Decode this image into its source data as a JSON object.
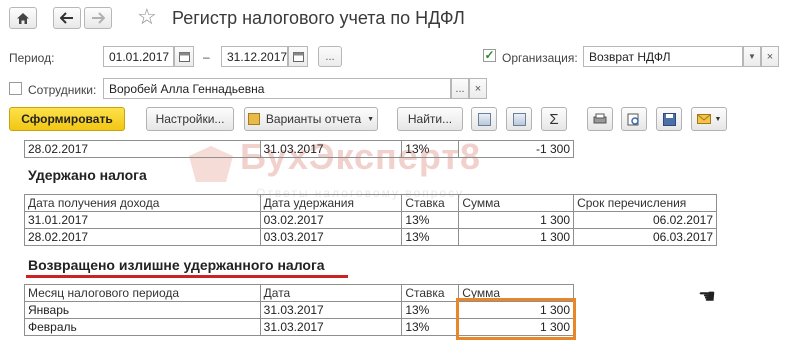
{
  "window": {
    "title": "Регистр налогового учета по НДФЛ",
    "home_icon": "home-icon",
    "back_icon": "arrow-left-icon",
    "forward_icon": "arrow-right-icon",
    "favorite_icon": "star-icon"
  },
  "filters": {
    "period_label": "Период:",
    "period_from": "01.01.2017",
    "period_dash": "–",
    "period_to": "31.12.2017",
    "period_more": "...",
    "org_checked": true,
    "org_label": "Организация:",
    "org_value": "Возврат НДФЛ",
    "emp_checked": false,
    "emp_label": "Сотрудники:",
    "emp_value": "Воробей Алла Геннадьевна",
    "emp_more": "...",
    "clear_glyph": "×"
  },
  "toolbar": {
    "generate": "Сформировать",
    "settings": "Настройки...",
    "variants": "Варианты отчета",
    "find": "Найти...",
    "sigma": "Σ"
  },
  "report": {
    "watermark": "БухЭксперт8",
    "watermark_sub": "Ответы налоговому вопросу",
    "top_row": [
      "28.02.2017",
      "31.03.2017",
      "13%",
      "-1 300"
    ],
    "withheld": {
      "title": "Удержано налога",
      "headers": [
        "Дата получения дохода",
        "Дата удержания",
        "Ставка",
        "Сумма",
        "Срок перечисления"
      ],
      "rows": [
        [
          "31.01.2017",
          "03.02.2017",
          "13%",
          "1 300",
          "06.02.2017"
        ],
        [
          "28.02.2017",
          "03.03.2017",
          "13%",
          "1 300",
          "06.03.2017"
        ]
      ]
    },
    "returned": {
      "title": "Возвращено излишне удержанного налога",
      "headers": [
        "Месяц налогового периода",
        "Дата",
        "Ставка",
        "Сумма"
      ],
      "rows": [
        [
          "Январь",
          "31.03.2017",
          "13%",
          "1 300"
        ],
        [
          "Февраль",
          "31.03.2017",
          "13%",
          "1 300"
        ]
      ]
    }
  },
  "colors": {
    "primary_button": "#f2c614",
    "highlight_frame": "#e8862a",
    "underline": "#cc2222",
    "watermark": "#f1d1cc"
  }
}
